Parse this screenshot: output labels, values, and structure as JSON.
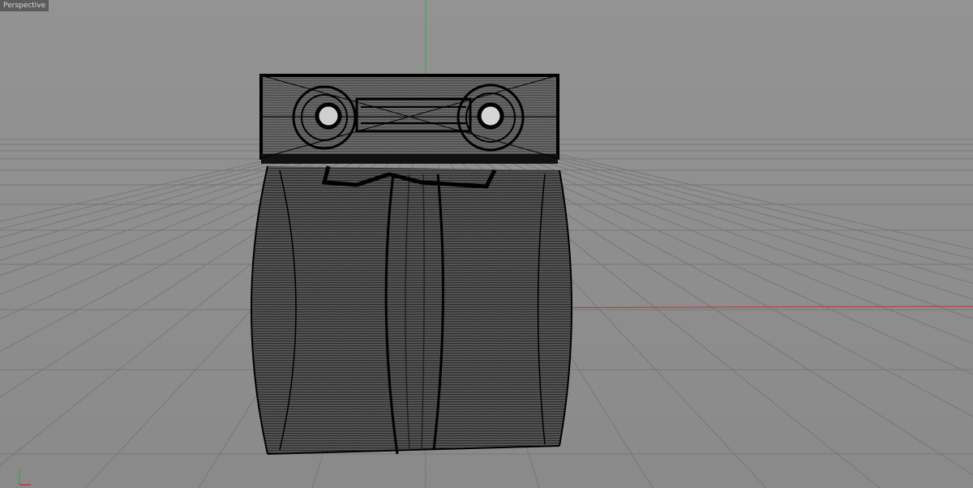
{
  "viewport": {
    "label": "Perspective",
    "background": "#8e8e8e",
    "grid_color": "#7a7a7a",
    "x_axis_color": "#c83232",
    "y_axis_color": "#3aa84a",
    "wireframe_color": "#000000"
  },
  "gizmo": {
    "y_icon": "axis-y-icon",
    "x_icon": "axis-x-icon"
  }
}
